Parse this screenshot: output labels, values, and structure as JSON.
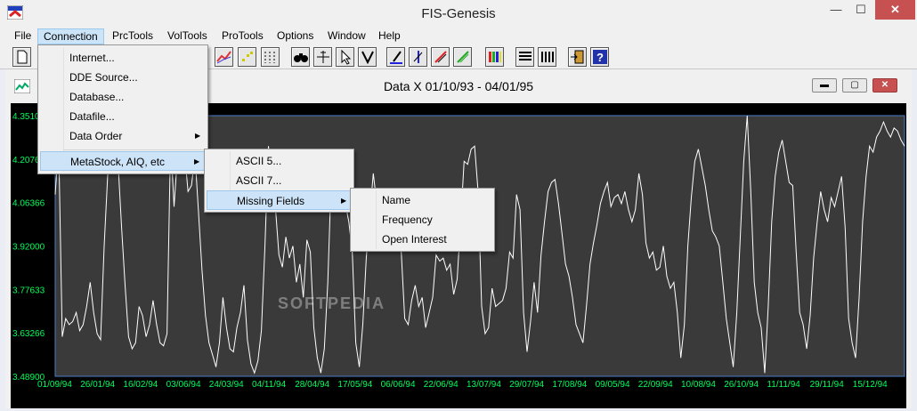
{
  "app": {
    "title": "FIS-Genesis",
    "close_glyph": "✕",
    "min_glyph": "—",
    "max_glyph": "☐"
  },
  "menubar": {
    "items": [
      "File",
      "Connection",
      "PrcTools",
      "VolTools",
      "ProTools",
      "Options",
      "Window",
      "Help"
    ],
    "active": "Connection"
  },
  "connection_menu": {
    "items": [
      "Internet...",
      "DDE Source...",
      "Database...",
      "Datafile...",
      "Data Order",
      "MetaStock, AIQ, etc"
    ],
    "highlighted": "MetaStock, AIQ, etc",
    "submenu_arrow": "▶"
  },
  "metastock_menu": {
    "items": [
      "ASCII 5...",
      "ASCII 7...",
      "Missing Fields"
    ],
    "highlighted": "Missing Fields"
  },
  "missing_fields_menu": {
    "items": [
      "Name",
      "Frequency",
      "Open Interest"
    ]
  },
  "child_window": {
    "title": "Data X 01/10/93 - 04/01/95",
    "min_glyph": "▬",
    "max_glyph": "▢",
    "close_glyph": "✕"
  },
  "watermark": "SOFTPEDIA",
  "colors": {
    "line": "#ffffff",
    "plot_bg": "#3a3a3a",
    "labels": "#00ff5a",
    "axis": "#4a7ec8"
  },
  "chart_data": {
    "type": "line",
    "title": "",
    "xlabel": "",
    "ylabel": "",
    "ylim": [
      3.489,
      4.351
    ],
    "y_ticks": [
      "4.35100",
      "4.20766",
      "4.06366",
      "3.92000",
      "3.77633",
      "3.63266",
      "3.48900"
    ],
    "x_ticks": [
      "01/09/94",
      "26/01/94",
      "16/02/94",
      "03/06/94",
      "24/03/94",
      "04/11/94",
      "28/04/94",
      "17/05/94",
      "06/06/94",
      "22/06/94",
      "13/07/94",
      "29/07/94",
      "17/08/94",
      "09/05/94",
      "22/09/94",
      "10/08/94",
      "26/10/94",
      "11/11/94",
      "29/11/94",
      "15/12/94"
    ],
    "series": [
      {
        "values": [
          4.09,
          4.26,
          3.62,
          3.68,
          3.66,
          3.67,
          3.7,
          3.64,
          3.66,
          3.72,
          3.8,
          3.7,
          3.63,
          3.61,
          3.92,
          4.15,
          4.3,
          4.25,
          4.19,
          3.98,
          3.79,
          3.62,
          3.58,
          3.6,
          3.72,
          3.69,
          3.62,
          3.66,
          3.74,
          3.66,
          3.6,
          3.59,
          3.63,
          4.27,
          4.05,
          4.22,
          4.18,
          4.23,
          4.1,
          4.12,
          4.22,
          4.03,
          3.84,
          3.69,
          3.6,
          3.56,
          3.52,
          3.6,
          3.75,
          3.65,
          3.58,
          3.57,
          3.65,
          3.7,
          3.79,
          3.61,
          3.53,
          3.5,
          3.54,
          3.64,
          3.92,
          4.25,
          4.15,
          4.05,
          3.89,
          3.85,
          3.95,
          3.88,
          3.92,
          3.8,
          3.86,
          3.75,
          3.94,
          3.9,
          3.65,
          3.55,
          3.5,
          3.58,
          3.8,
          4.15,
          4.22,
          4.17,
          4.09,
          4.06,
          4.0,
          3.9,
          3.6,
          3.52,
          3.66,
          3.88,
          4.02,
          4.16,
          4.06,
          4.04,
          4.08,
          4.03,
          3.98,
          4.06,
          4.09,
          3.9,
          3.68,
          3.66,
          3.74,
          3.79,
          3.72,
          3.75,
          3.65,
          3.7,
          3.75,
          3.89,
          3.87,
          3.88,
          3.84,
          3.86,
          3.76,
          3.81,
          4.0,
          4.2,
          4.19,
          4.24,
          4.25,
          4.1,
          3.72,
          3.63,
          3.65,
          3.78,
          3.72,
          3.73,
          3.74,
          3.78,
          3.9,
          3.88,
          4.09,
          4.04,
          3.7,
          3.57,
          3.67,
          3.8,
          3.7,
          3.89,
          4.0,
          4.1,
          4.13,
          4.14,
          4.06,
          3.96,
          3.86,
          3.82,
          3.75,
          3.66,
          3.63,
          3.6,
          3.72,
          3.86,
          3.93,
          3.99,
          4.06,
          4.1,
          4.13,
          4.05,
          4.08,
          4.09,
          4.06,
          4.1,
          4.04,
          4.0,
          4.04,
          4.16,
          4.09,
          3.93,
          3.88,
          3.9,
          3.84,
          3.85,
          3.92,
          3.82,
          3.78,
          3.8,
          3.7,
          3.55,
          3.66,
          3.92,
          4.08,
          4.2,
          4.24,
          4.18,
          4.12,
          4.04,
          3.97,
          3.95,
          3.92,
          3.8,
          3.68,
          3.6,
          3.52,
          3.7,
          3.95,
          4.2,
          4.36,
          4.1,
          3.8,
          3.7,
          3.65,
          3.5,
          3.72,
          4.0,
          4.15,
          4.23,
          4.27,
          4.2,
          4.13,
          4.12,
          3.9,
          3.7,
          3.66,
          3.58,
          3.69,
          3.88,
          4.0,
          4.1,
          4.04,
          4.0,
          4.08,
          4.05,
          4.1,
          4.15,
          3.98,
          3.68,
          3.6,
          3.55,
          3.75,
          4.0,
          4.15,
          4.25,
          4.23,
          4.28,
          4.3,
          4.33,
          4.3,
          4.28,
          4.31,
          4.3,
          4.27,
          4.25
        ]
      }
    ]
  }
}
